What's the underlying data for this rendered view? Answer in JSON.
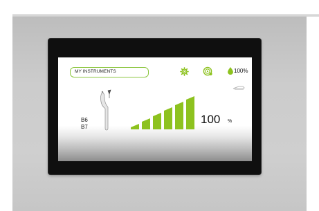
{
  "header": {
    "title": "MY INSTRUMENTS"
  },
  "status": {
    "water_level": "100%"
  },
  "instrument": {
    "label_top": "B6",
    "label_bottom": "B7"
  },
  "power": {
    "value": "100",
    "unit": "%",
    "bars_total": 6,
    "bars_lit": 6
  },
  "icons": {
    "settings": "gear-icon",
    "spray": "spray-icon",
    "water": "water-drop-icon",
    "handpiece": "handpiece-icon",
    "instrument": "instrument-tip-icon"
  },
  "colors": {
    "accent": "#8dc21f",
    "title_border": "#8cc63f",
    "bezel": "#0f0f0f",
    "panel": "#c9c9c9"
  }
}
